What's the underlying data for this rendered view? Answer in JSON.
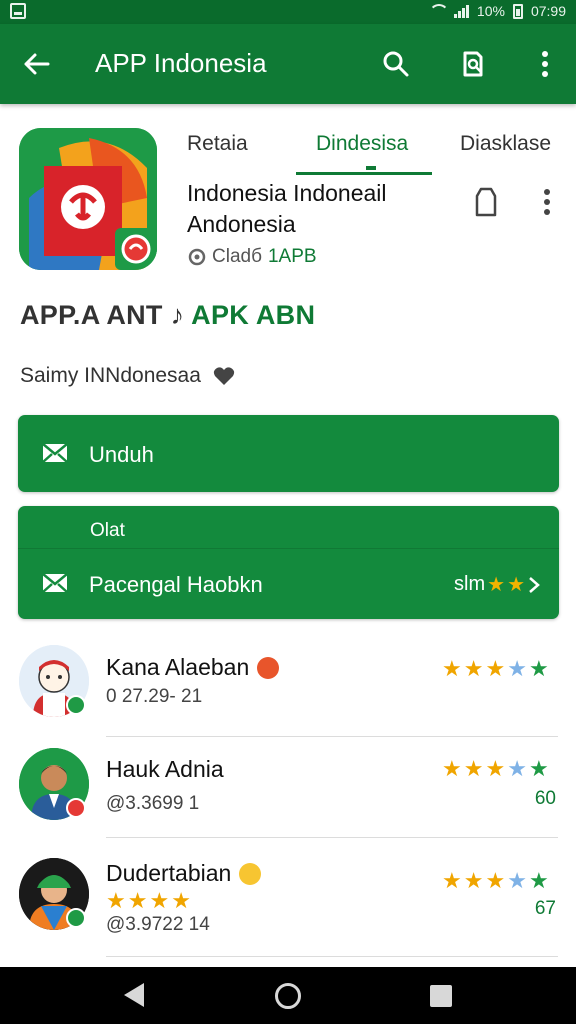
{
  "status": {
    "signal_text": "10%",
    "time": "07:99"
  },
  "appbar": {
    "title": "APP Indonesia",
    "back_icon": "arrow-left-icon",
    "search_icon": "search-icon",
    "bookmark_icon": "bookmark-icon",
    "menu_icon": "more-vert-icon"
  },
  "tabs": [
    {
      "label": "Retaia"
    },
    {
      "label": "Dindesisa"
    },
    {
      "label": "Diasklase"
    }
  ],
  "app": {
    "name": "Indonesia Indoneail Andonesia",
    "developer_prefix": "Cladб",
    "developer_tag": "1APB"
  },
  "subtitle": {
    "main": "APP.A ANT",
    "mark": "♪",
    "highlight": "APK ABN"
  },
  "subtitle2": {
    "text": "Saimy INNdonesaa",
    "heart_icon": "heart-icon"
  },
  "download": {
    "label": "Unduh",
    "icon": "mail-icon"
  },
  "card": {
    "header": "Olat",
    "row_label": "Pacengal Haobkn",
    "row_right_text": "slm",
    "row_icon": "mail-icon",
    "chevron_icon": "chevron-right-icon"
  },
  "reviews": [
    {
      "name": "Kana Alaeban",
      "emoji": "🙃",
      "meta": "0 27.29- 21",
      "count": ""
    },
    {
      "name": "Hauk Adnia",
      "emoji": "",
      "meta": "@3.3699  1",
      "count": "60"
    },
    {
      "name": "Dudertabian",
      "emoji": "😊",
      "meta": "@3.9722 14",
      "count": "67"
    }
  ],
  "colors": {
    "primary": "#0f7a35",
    "button": "#138a3d",
    "star": "#f4b400"
  }
}
